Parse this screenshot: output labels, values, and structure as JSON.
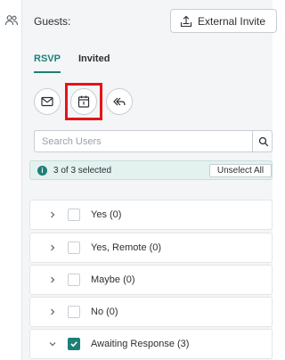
{
  "header": {
    "guests_label": "Guests:",
    "external_invite_label": "External Invite"
  },
  "tabs": [
    {
      "label": "RSVP",
      "active": true
    },
    {
      "label": "Invited",
      "active": false
    }
  ],
  "actions": {
    "icons": [
      "mail-icon",
      "calendar-icon",
      "reply-all-icon"
    ]
  },
  "search": {
    "placeholder": "Search Users",
    "value": ""
  },
  "selection": {
    "count_text": "3 of 3 selected",
    "unselect_label": "Unselect All"
  },
  "groups": [
    {
      "label": "Yes (0)",
      "expanded": false,
      "checked": false
    },
    {
      "label": "Yes, Remote (0)",
      "expanded": false,
      "checked": false
    },
    {
      "label": "Maybe (0)",
      "expanded": false,
      "checked": false
    },
    {
      "label": "No (0)",
      "expanded": false,
      "checked": false
    },
    {
      "label": "Awaiting Response (3)",
      "expanded": true,
      "checked": true
    }
  ],
  "colors": {
    "accent": "#1d7f78",
    "highlight": "#e3151a"
  }
}
